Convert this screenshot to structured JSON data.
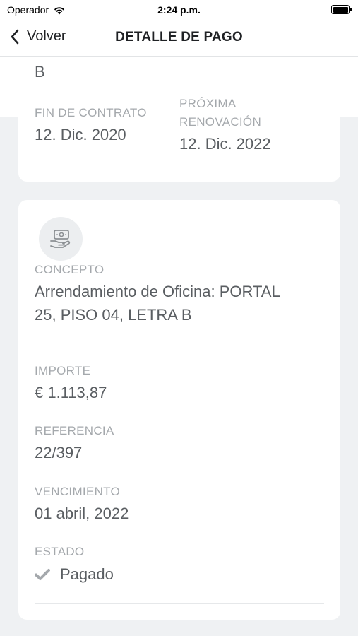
{
  "status_bar": {
    "carrier": "Operador",
    "time": "2:24 p.m."
  },
  "nav": {
    "back_label": "Volver",
    "title": "DETALLE DE PAGO"
  },
  "contract": {
    "partial_text": "B",
    "end_label": "FIN DE CONTRATO",
    "end_value": "12. Dic. 2020",
    "renewal_label_line1": "PRÓXIMA",
    "renewal_label_line2": "RENOVACIÓN",
    "renewal_value": "12. Dic. 2022"
  },
  "payment": {
    "icon": "cash-hand-icon",
    "concept_label": "CONCEPTO",
    "concept_line1": "Arrendamiento de Oficina: PORTAL",
    "concept_line2": "25, PISO 04, LETRA B",
    "amount_label": "IMPORTE",
    "amount_value": "€ 1.113,87",
    "reference_label": "REFERENCIA",
    "reference_value": "22/397",
    "due_label": "VENCIMIENTO",
    "due_value": "01 abril, 2022",
    "status_label": "ESTADO",
    "status_value": "Pagado",
    "status_icon": "checkmark-icon"
  },
  "colors": {
    "background": "#eff1f3",
    "card": "#ffffff",
    "label": "#a4a8ac",
    "value": "#5a5e62"
  }
}
